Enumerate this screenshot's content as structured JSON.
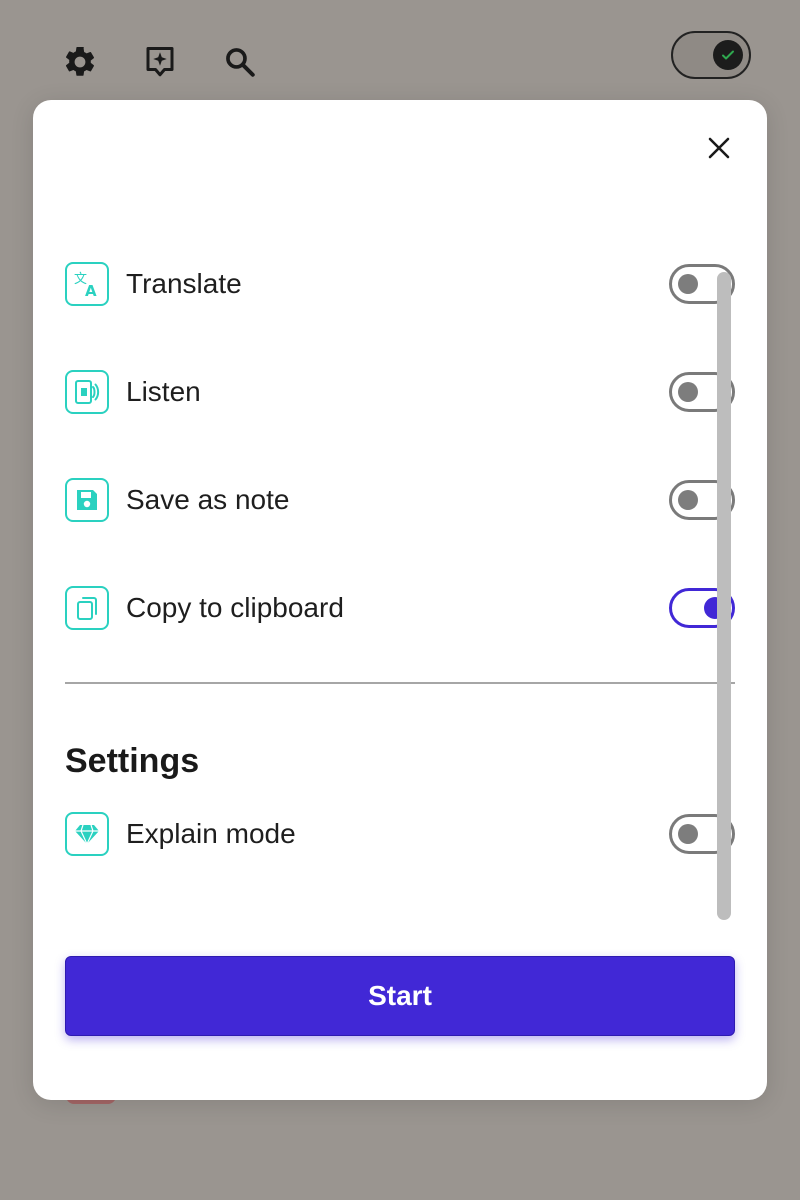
{
  "toolbar": {
    "icons": [
      "gear-icon",
      "sparkle-note-icon",
      "search-icon"
    ],
    "toggle_on": true
  },
  "modal": {
    "close_icon": "close-icon",
    "actions": [
      {
        "label": "",
        "icon": "speaker-icon",
        "enabled": false
      },
      {
        "label": "Translate",
        "icon": "translate-icon",
        "enabled": false
      },
      {
        "label": "Listen",
        "icon": "listen-icon",
        "enabled": false
      },
      {
        "label": "Save as note",
        "icon": "save-icon",
        "enabled": false
      },
      {
        "label": "Copy to clipboard",
        "icon": "copy-icon",
        "enabled": true
      }
    ],
    "settings": {
      "title": "Settings",
      "items": [
        {
          "label": "Explain mode",
          "icon": "diamond-icon",
          "enabled": false
        }
      ]
    },
    "start_label": "Start"
  },
  "colors": {
    "accent": "#4128d6",
    "icon_teal": "#2ad1c0",
    "backdrop": "#9a9590"
  }
}
